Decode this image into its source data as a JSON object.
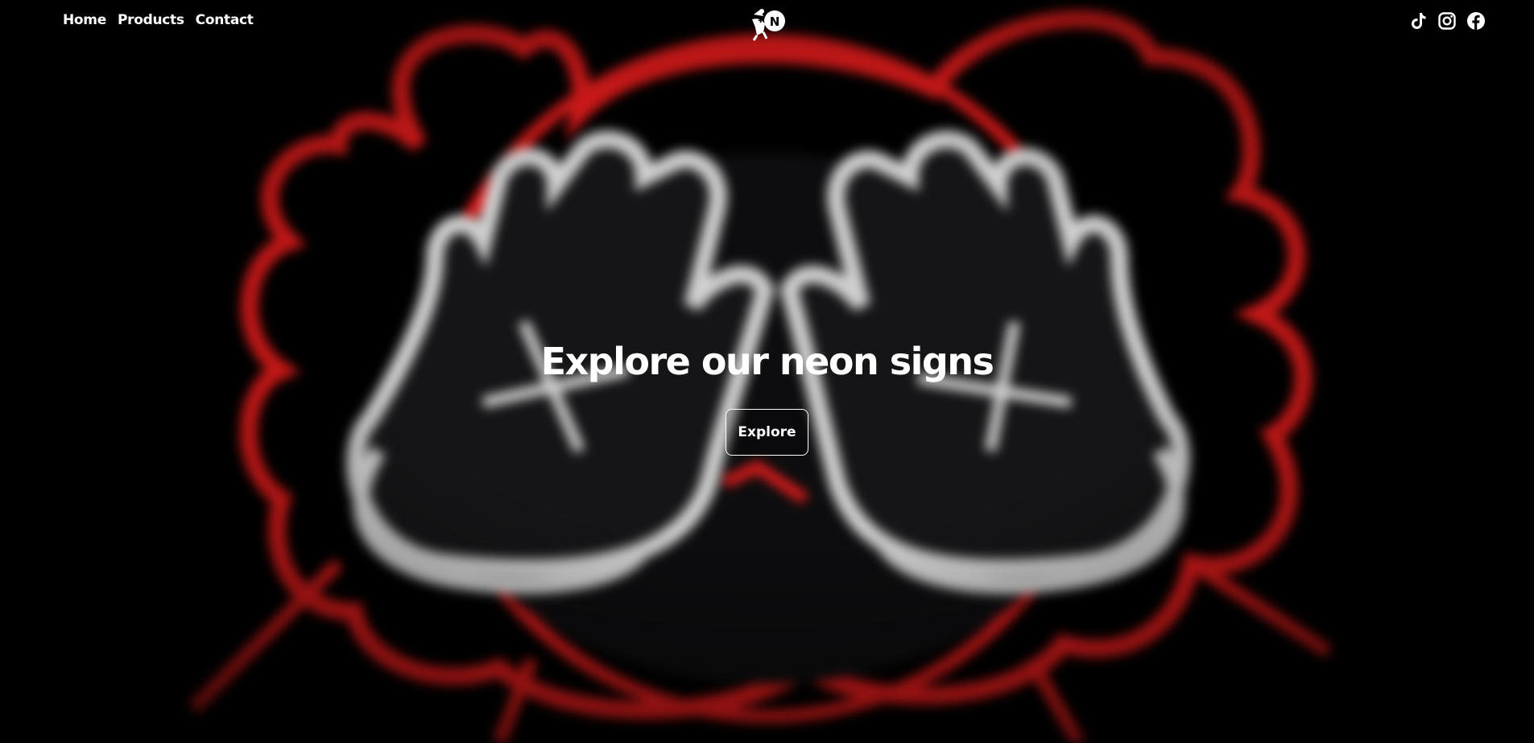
{
  "nav": {
    "links": [
      {
        "label": "Home"
      },
      {
        "label": "Products"
      },
      {
        "label": "Contact"
      }
    ],
    "logo_icon": "neon-mascot-logo-icon",
    "socials": [
      {
        "icon": "tiktok-icon"
      },
      {
        "icon": "instagram-icon"
      },
      {
        "icon": "facebook-icon"
      }
    ]
  },
  "hero": {
    "title": "Explore our neon signs",
    "button_label": "Explore",
    "background": "blurred red and white neon sign of two hands covering a face",
    "colors": {
      "neon_red": "#e01b1b",
      "neon_white": "#d9d9d9",
      "background": "#000000",
      "text": "#ffffff"
    }
  }
}
